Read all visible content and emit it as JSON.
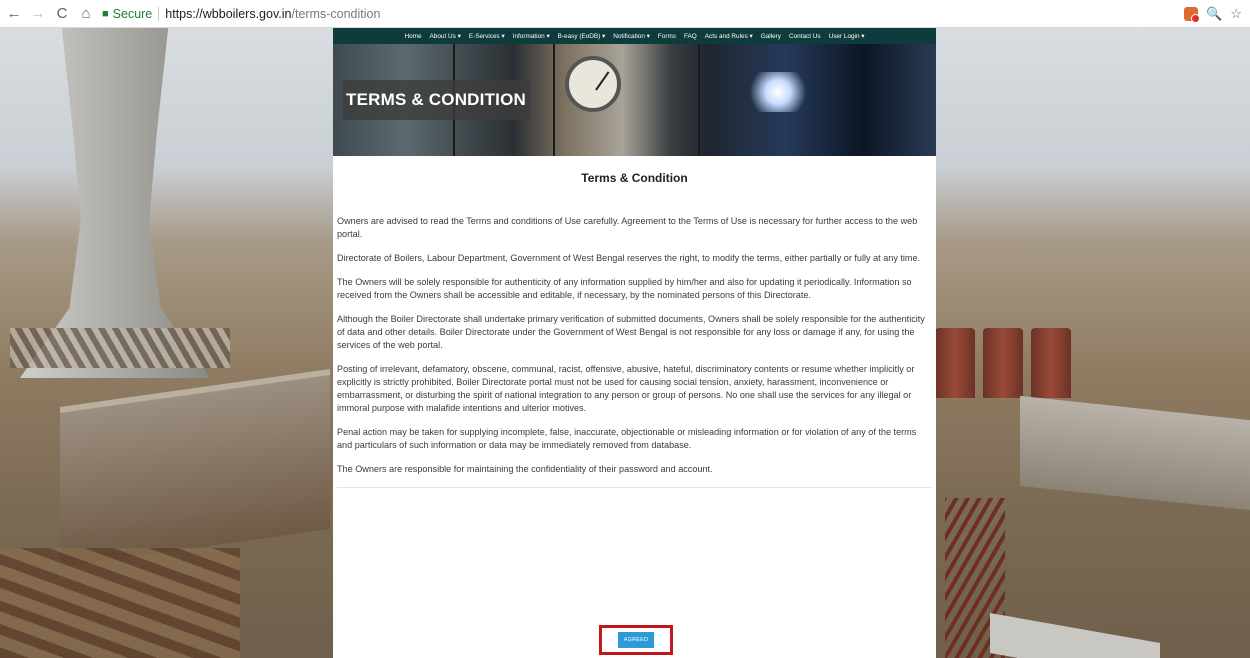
{
  "browser": {
    "back_icon": "←",
    "forward_icon": "→",
    "reload_icon": "C",
    "home_icon": "⌂",
    "secure_label": "Secure",
    "url_host": "https://wbboilers.gov.in",
    "url_path": "/terms-condition",
    "zoom_icon": "🔍",
    "star_icon": "☆"
  },
  "site_nav": {
    "items": [
      "Home",
      "About Us ▾",
      "E-Services ▾",
      "Information ▾",
      "B-easy (EoDB) ▾",
      "Notification ▾",
      "Forms",
      "FAQ",
      "Acts and Rules ▾",
      "Gallery",
      "Contact Us",
      "User Login ▾"
    ]
  },
  "banner": {
    "title": "TERMS & CONDITION"
  },
  "content": {
    "title": "Terms & Condition",
    "paragraphs": [
      "Owners are advised to read the Terms and conditions of Use carefully. Agreement to the Terms of Use is necessary for further access to the web portal.",
      "Directorate of Boilers, Labour Department, Government of West Bengal reserves the right, to modify the terms, either partially or fully at any time.",
      "The Owners will be solely responsible for authenticity of any information supplied by him/her and also for updating it periodically. Information so received from the Owners shall be accessible and editable, if necessary, by the nominated persons of this Directorate.",
      "Although the Boiler Directorate shall undertake primary verification of submitted documents, Owners shall be solely responsible for the authenticity of data and other details. Boiler Directorate under the Government of West Bengal is not responsible for any loss or damage if any, for using the services of the web portal.",
      "Posting of irrelevant, defamatory, obscene, communal, racist, offensive, abusive, hateful, discriminatory contents or resume whether implicitly or explicitly is strictly prohibited. Boiler Directorate portal must not be used for causing social tension, anxiety, harassment, inconvenience or embarrassment, or disturbing the spirit of national integration to any person or group of persons. No one shall use the services for any illegal or immoral purpose with malafide intentions and ulterior motives.",
      "Penal action may be taken for supplying incomplete, false, inaccurate, objectionable or misleading information or for violation of any of the terms and particulars of such information or data may be immediately removed from database.",
      "The Owners are responsible for maintaining the confidentiality of their password and account."
    ]
  },
  "agreed_button": {
    "label": "AGREED"
  },
  "colors": {
    "nav_bg": "#0e3b3c",
    "button_bg": "#2b9cd8",
    "highlight_border": "#c4161c",
    "secure_green": "#188038"
  }
}
